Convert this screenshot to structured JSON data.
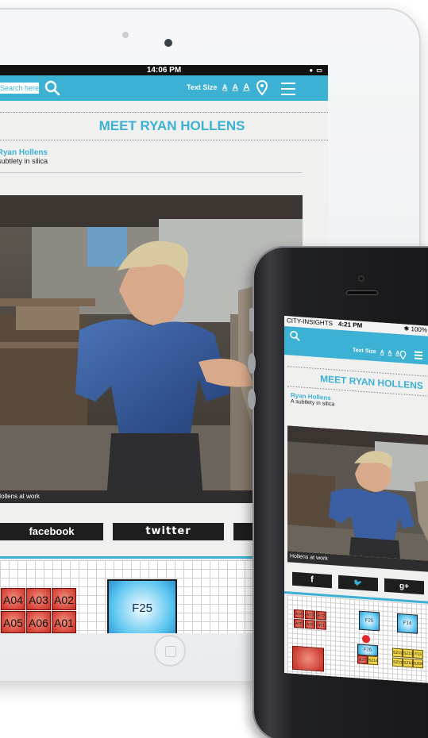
{
  "tablet": {
    "status_time": "14:06 PM",
    "status_icons": "● ▭",
    "search_placeholder": "Search here",
    "text_size_label": "Text Size",
    "text_size_options": [
      "A",
      "A",
      "A"
    ],
    "page_title": "MEET RYAN HOLLENS",
    "artist_name": "Ryan Hollens",
    "artist_subtitle": "A subtlety in silica",
    "photo_caption": "Hollens at work",
    "social": {
      "facebook": "facebook",
      "twitter": "twitter"
    },
    "map_seats": [
      "A04",
      "A03",
      "A02",
      "A05",
      "A06",
      "A01"
    ],
    "map_booth": "F25"
  },
  "phone": {
    "carrier": "CITY-INSIGHTS",
    "status_time": "4:21 PM",
    "battery": "✱ 100%",
    "text_size_label": "Text Size",
    "text_size_options": [
      "A",
      "A",
      "A"
    ],
    "page_title": "MEET RYAN HOLLENS",
    "artist_name": "Ryan Hollens",
    "artist_subtitle": "A subtlety in silica",
    "photo_caption": "Hollens at work",
    "social": {
      "facebook": "f",
      "twitter": "🐦",
      "googleplus": "g+"
    },
    "map_seats": [
      "A04",
      "A03",
      "A02",
      "A05",
      "A06",
      "A01"
    ],
    "map_booths": [
      "F25",
      "F14",
      "F26"
    ],
    "map_small": [
      "A37",
      "SZ14",
      "SZ12",
      "SZ13",
      "F13",
      "SZ11",
      "SZ10",
      "SZ09"
    ]
  },
  "colors": {
    "accent": "#3db1d4",
    "dark": "#1e1e1e",
    "seat_red": "#cc2a20"
  }
}
